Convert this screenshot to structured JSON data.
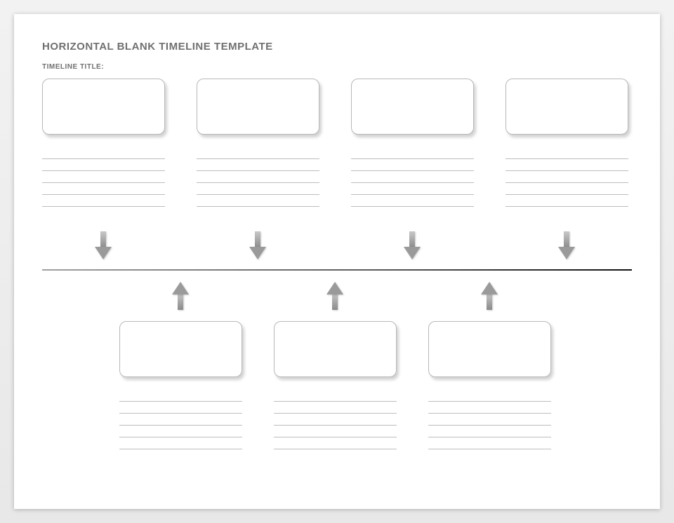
{
  "header": {
    "title": "HORIZONTAL BLANK TIMELINE TEMPLATE",
    "subtitle": "TIMELINE TITLE:"
  },
  "top_events": [
    {
      "card_text": "",
      "detail_lines": [
        "",
        "",
        "",
        "",
        ""
      ]
    },
    {
      "card_text": "",
      "detail_lines": [
        "",
        "",
        "",
        "",
        ""
      ]
    },
    {
      "card_text": "",
      "detail_lines": [
        "",
        "",
        "",
        "",
        ""
      ]
    },
    {
      "card_text": "",
      "detail_lines": [
        "",
        "",
        "",
        "",
        ""
      ]
    }
  ],
  "bottom_events": [
    {
      "card_text": "",
      "detail_lines": [
        "",
        "",
        "",
        "",
        ""
      ]
    },
    {
      "card_text": "",
      "detail_lines": [
        "",
        "",
        "",
        "",
        ""
      ]
    },
    {
      "card_text": "",
      "detail_lines": [
        "",
        "",
        "",
        "",
        ""
      ]
    }
  ]
}
